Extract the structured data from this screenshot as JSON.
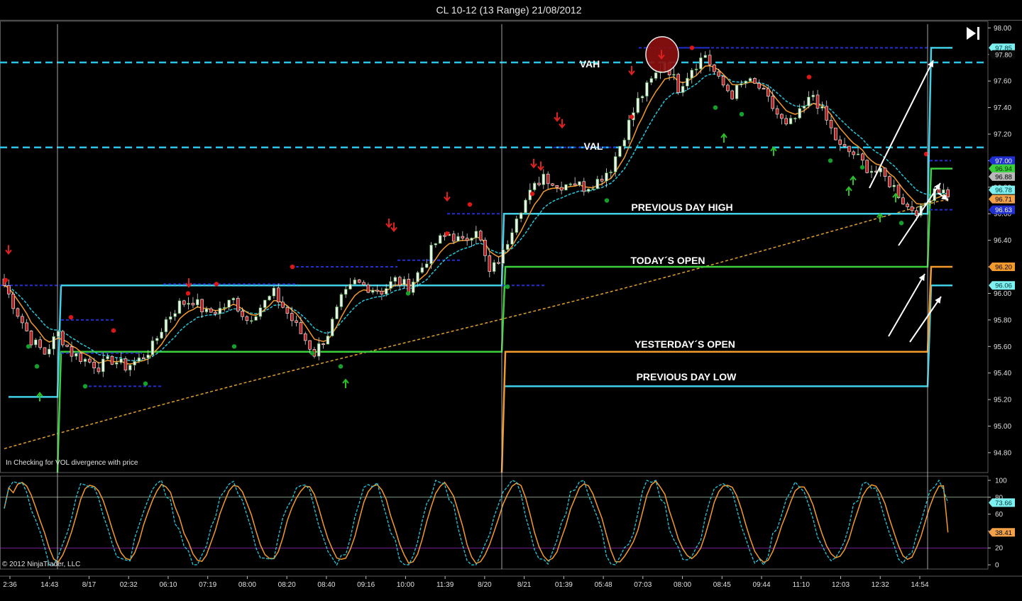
{
  "window": {
    "title": "CL 10-12 (13 Range)  21/08/2012",
    "play_icon": "skip-to-end-icon"
  },
  "chart_data": {
    "type": "candlestick",
    "instrument": "CL 10-12",
    "bar_type": "13 Range",
    "date": "21/08/2012",
    "price_panel": {
      "y_ticks": [
        98.0,
        97.8,
        97.6,
        97.4,
        97.2,
        97.0,
        96.8,
        96.6,
        96.4,
        96.2,
        96.0,
        95.8,
        95.6,
        95.4,
        95.2,
        95.0,
        94.8
      ],
      "ylim": [
        94.65,
        98.05
      ],
      "x_ticks": [
        "2:36",
        "14:43",
        "8/17",
        "02:32",
        "06:10",
        "07:19",
        "08:00",
        "08:20",
        "08:40",
        "09:16",
        "10:00",
        "11:39",
        "8/20",
        "8/21",
        "01:39",
        "05:48",
        "07:03",
        "08:00",
        "08:45",
        "09:44",
        "11:10",
        "12:03",
        "12:32",
        "14:54"
      ],
      "close_path": [
        [
          0,
          96.06
        ],
        [
          3,
          95.85
        ],
        [
          6,
          95.65
        ],
        [
          9,
          95.55
        ],
        [
          12,
          95.7
        ],
        [
          15,
          95.55
        ],
        [
          18,
          95.5
        ],
        [
          21,
          95.45
        ],
        [
          24,
          95.5
        ],
        [
          27,
          95.45
        ],
        [
          30,
          95.5
        ],
        [
          33,
          95.6
        ],
        [
          36,
          95.8
        ],
        [
          39,
          95.92
        ],
        [
          42,
          95.95
        ],
        [
          45,
          95.85
        ],
        [
          48,
          95.88
        ],
        [
          51,
          95.95
        ],
        [
          54,
          95.8
        ],
        [
          57,
          95.9
        ],
        [
          60,
          96.0
        ],
        [
          63,
          95.85
        ],
        [
          66,
          95.7
        ],
        [
          69,
          95.55
        ],
        [
          72,
          95.7
        ],
        [
          75,
          95.95
        ],
        [
          78,
          96.08
        ],
        [
          81,
          96.05
        ],
        [
          84,
          96.02
        ],
        [
          87,
          96.1
        ],
        [
          90,
          96.05
        ],
        [
          93,
          96.2
        ],
        [
          96,
          96.38
        ],
        [
          99,
          96.45
        ],
        [
          102,
          96.38
        ],
        [
          105,
          96.5
        ],
        [
          108,
          96.15
        ],
        [
          111,
          96.3
        ],
        [
          114,
          96.6
        ],
        [
          117,
          96.75
        ],
        [
          120,
          96.9
        ],
        [
          123,
          96.8
        ],
        [
          126,
          96.85
        ],
        [
          129,
          96.8
        ],
        [
          132,
          96.85
        ],
        [
          135,
          96.95
        ],
        [
          138,
          97.2
        ],
        [
          141,
          97.45
        ],
        [
          144,
          97.6
        ],
        [
          147,
          97.75
        ],
        [
          150,
          97.55
        ],
        [
          153,
          97.7
        ],
        [
          156,
          97.8
        ],
        [
          159,
          97.6
        ],
        [
          162,
          97.5
        ],
        [
          165,
          97.6
        ],
        [
          168,
          97.55
        ],
        [
          171,
          97.4
        ],
        [
          174,
          97.25
        ],
        [
          177,
          97.35
        ],
        [
          180,
          97.5
        ],
        [
          183,
          97.3
        ],
        [
          186,
          97.1
        ],
        [
          189,
          97.05
        ],
        [
          192,
          96.95
        ],
        [
          195,
          96.9
        ],
        [
          198,
          96.8
        ],
        [
          201,
          96.65
        ],
        [
          204,
          96.62
        ],
        [
          207,
          96.8
        ],
        [
          210,
          96.75
        ]
      ],
      "indicator_lines": {
        "fast_ma_color": "#f39a2c",
        "slow_ma_color": "#26c6da",
        "long_ma_color": "#e0a030"
      },
      "levels": [
        {
          "name": "VAH",
          "value": 97.74,
          "color": "#29c5e6",
          "style": "dashed"
        },
        {
          "name": "VAL",
          "value": 97.1,
          "color": "#29c5e6",
          "style": "dashed"
        },
        {
          "name": "PREVIOUS DAY HIGH",
          "value": 96.6,
          "color": "#3fd0e8"
        },
        {
          "name": "TODAY´S OPEN",
          "value": 96.2,
          "color": "#3cd03c"
        },
        {
          "name": "YESTERDAY´S OPEN",
          "value": 95.56,
          "color": "#f39a2c"
        },
        {
          "name": "PREVIOUS DAY LOW",
          "value": 95.3,
          "color": "#3fd0e8"
        }
      ],
      "price_tags": [
        {
          "label": "97.85",
          "value": 97.85,
          "bg": "#7ff0f0",
          "fg": "#003b3b"
        },
        {
          "label": "97.80",
          "value": 97.8,
          "bg": "#0a0a0a",
          "fg": "#e0e0e0"
        },
        {
          "label": "97.00",
          "value": 97.0,
          "bg": "#1f2fd0",
          "fg": "#ffffff"
        },
        {
          "label": "96.94",
          "value": 96.94,
          "bg": "#3cd03c",
          "fg": "#003300"
        },
        {
          "label": "96.88",
          "value": 96.88,
          "bg": "#b9b9b9",
          "fg": "#000000"
        },
        {
          "label": "96.78",
          "value": 96.78,
          "bg": "#7ff0f0",
          "fg": "#003b3b"
        },
        {
          "label": "96.71",
          "value": 96.71,
          "bg": "#f3a24a",
          "fg": "#000000"
        },
        {
          "label": "96.63",
          "value": 96.63,
          "bg": "#1f2fd0",
          "fg": "#ffffff"
        },
        {
          "label": "96.20",
          "value": 96.2,
          "bg": "#f39a2c",
          "fg": "#000000"
        },
        {
          "label": "96.06",
          "value": 96.06,
          "bg": "#7ff0f0",
          "fg": "#003b3b"
        }
      ],
      "annotation": "In  Checking for VOL  divergence with price"
    },
    "oscillator_panel": {
      "y_ticks": [
        100,
        80,
        60,
        40,
        20,
        0
      ],
      "ylim": [
        -5,
        105
      ],
      "tags": [
        {
          "label": "73.66",
          "value": 73.66,
          "bg": "#7ff0f0",
          "fg": "#003b3b"
        },
        {
          "label": "38.41",
          "value": 38.41,
          "bg": "#f3a24a",
          "fg": "#000000"
        }
      ],
      "series_colors": {
        "k": "#f39a2c",
        "d": "#26c6da"
      }
    }
  },
  "footer": {
    "copyright": "© 2012 NinjaTrader, LLC"
  }
}
